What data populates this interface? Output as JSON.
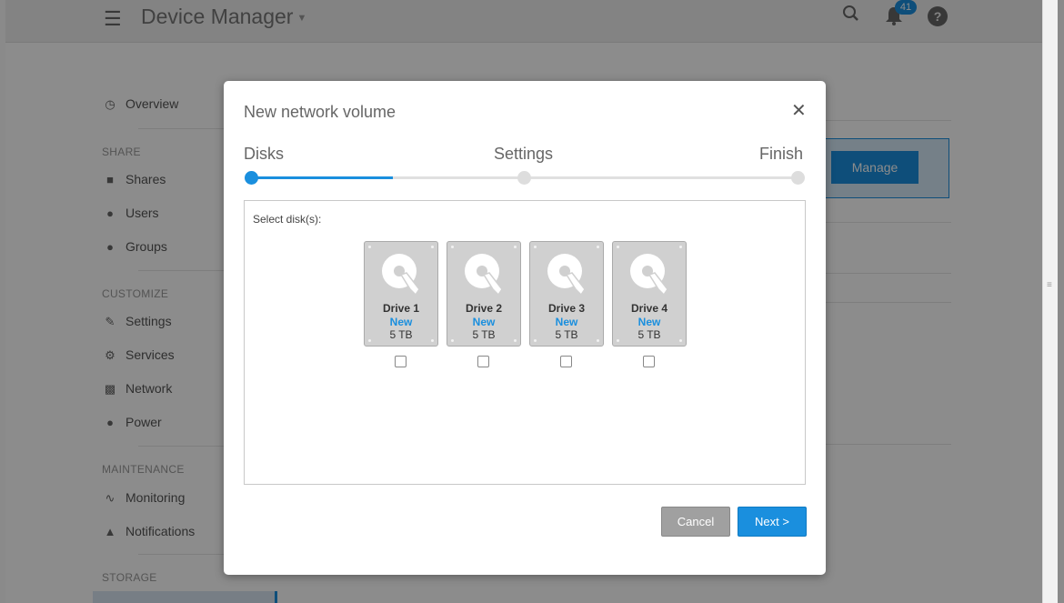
{
  "topbar": {
    "title": "Device Manager",
    "notification_count": "41"
  },
  "sidebar": {
    "overview": "Overview",
    "sections": [
      {
        "heading": "SHARE",
        "items": [
          "Shares",
          "Users",
          "Groups"
        ]
      },
      {
        "heading": "CUSTOMIZE",
        "items": [
          "Settings",
          "Services",
          "Network",
          "Power"
        ]
      },
      {
        "heading": "MAINTENANCE",
        "items": [
          "Monitoring",
          "Notifications"
        ]
      },
      {
        "heading": "STORAGE",
        "items": []
      }
    ]
  },
  "background": {
    "manage_label": "Manage"
  },
  "modal": {
    "title": "New network volume",
    "steps": [
      "Disks",
      "Settings",
      "Finish"
    ],
    "progress": 0.26,
    "select_label": "Select disk(s):",
    "drives": [
      {
        "name": "Drive 1",
        "status": "New",
        "size": "5 TB"
      },
      {
        "name": "Drive 2",
        "status": "New",
        "size": "5 TB"
      },
      {
        "name": "Drive 3",
        "status": "New",
        "size": "5 TB"
      },
      {
        "name": "Drive 4",
        "status": "New",
        "size": "5 TB"
      }
    ],
    "cancel_label": "Cancel",
    "next_label": "Next >"
  },
  "colors": {
    "accent": "#1a8fde",
    "cancel": "#a0a0a0"
  }
}
